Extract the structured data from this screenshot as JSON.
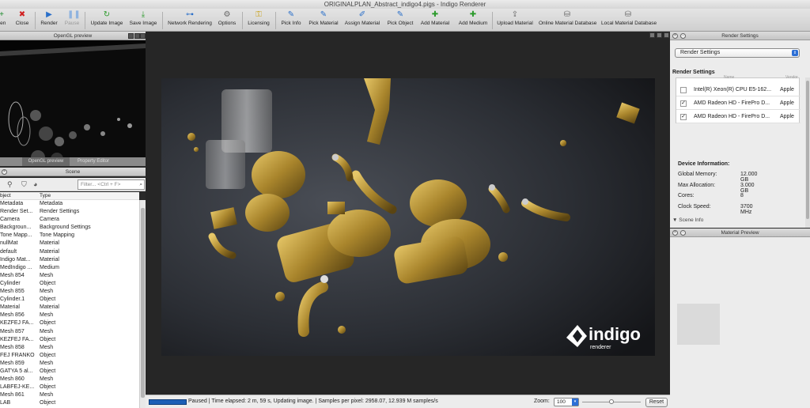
{
  "window": {
    "title": "ORIGINALPLAN_Abstract_indigo4.pigs - Indigo Renderer"
  },
  "toolbar": {
    "open": "pen",
    "close": "Close",
    "render": "Render",
    "pause": "Pause",
    "update_image": "Update Image",
    "save_image": "Save Image",
    "network_rendering": "Network Rendering",
    "options": "Options",
    "licensing": "Licensing",
    "pick_info": "Pick Info",
    "pick_material": "Pick Material",
    "assign_material": "Assign Material",
    "pick_object": "Pick Object",
    "add_material": "Add Material",
    "add_medium": "Add Medium",
    "upload_material": "Upload Material",
    "online_material_database": "Online Material Database",
    "local_material_database": "Local Material Database"
  },
  "opengl": {
    "title": "OpenGL preview",
    "tabs": [
      "OpenGL preview",
      "Property Editor"
    ]
  },
  "scene": {
    "title": "Scene",
    "filter_placeholder": "Filter... <Ctrl + F>",
    "col_object": "bject",
    "col_type": "Type",
    "rows": [
      [
        "Metadata",
        "Metadata"
      ],
      [
        "Render Set...",
        "Render Settings"
      ],
      [
        "Camera",
        "Camera"
      ],
      [
        "Backgroun...",
        "Background Settings"
      ],
      [
        "Tone Mapp...",
        "Tone Mapping"
      ],
      [
        "nullMat",
        "Material"
      ],
      [
        "default",
        "Material"
      ],
      [
        "Indigo Mat...",
        "Material"
      ],
      [
        "MedIndigo ...",
        "Medium"
      ],
      [
        "Mesh 854",
        "Mesh"
      ],
      [
        "Cylinder",
        "Object"
      ],
      [
        "Mesh 855",
        "Mesh"
      ],
      [
        "Cylinder.1",
        "Object"
      ],
      [
        "Material",
        "Material"
      ],
      [
        "Mesh 856",
        "Mesh"
      ],
      [
        "KEZFEJ FA...",
        "Object"
      ],
      [
        "Mesh 857",
        "Mesh"
      ],
      [
        "KEZFEJ FA...",
        "Object"
      ],
      [
        "Mesh 858",
        "Mesh"
      ],
      [
        "FEJ FRANKO",
        "Object"
      ],
      [
        "Mesh 859",
        "Mesh"
      ],
      [
        "GATYA 5 al...",
        "Object"
      ],
      [
        "Mesh 860",
        "Mesh"
      ],
      [
        "LABFEJ-KE...",
        "Object"
      ],
      [
        "Mesh 861",
        "Mesh"
      ],
      [
        "LAB",
        "Object"
      ]
    ]
  },
  "status": {
    "text": "Paused | Time elapsed: 2 m, 59 s, Updating image. | Samples per pixel: 2958.07, 12.939 M samples/s",
    "zoom_label": "Zoom:",
    "zoom_value": "100",
    "reset": "Reset"
  },
  "render_settings": {
    "title": "Render Settings",
    "dropdown": "Render Settings",
    "section": "Render Settings",
    "col_name": "Name",
    "col_vendor": "Vendor",
    "devices": [
      {
        "checked": false,
        "name": "Intel(R) Xeon(R) CPU E5-162...",
        "vendor": "Apple"
      },
      {
        "checked": true,
        "name": "AMD Radeon HD - FirePro D...",
        "vendor": "Apple"
      },
      {
        "checked": true,
        "name": "AMD Radeon HD - FirePro D...",
        "vendor": "Apple"
      }
    ],
    "device_info_title": "Device Information:",
    "info": [
      {
        "label": "Global Memory:",
        "value": "12.000 GB"
      },
      {
        "label": "Max Allocation:",
        "value": "3.000 GB"
      },
      {
        "label": "Cores:",
        "value": "8"
      },
      {
        "label": "Clock Speed:",
        "value": "3700 MHz"
      }
    ],
    "scene_info": "Scene Info"
  },
  "material_preview": {
    "title": "Material Preview"
  },
  "render": {
    "logo_text": "indigo",
    "logo_sub": "renderer"
  }
}
